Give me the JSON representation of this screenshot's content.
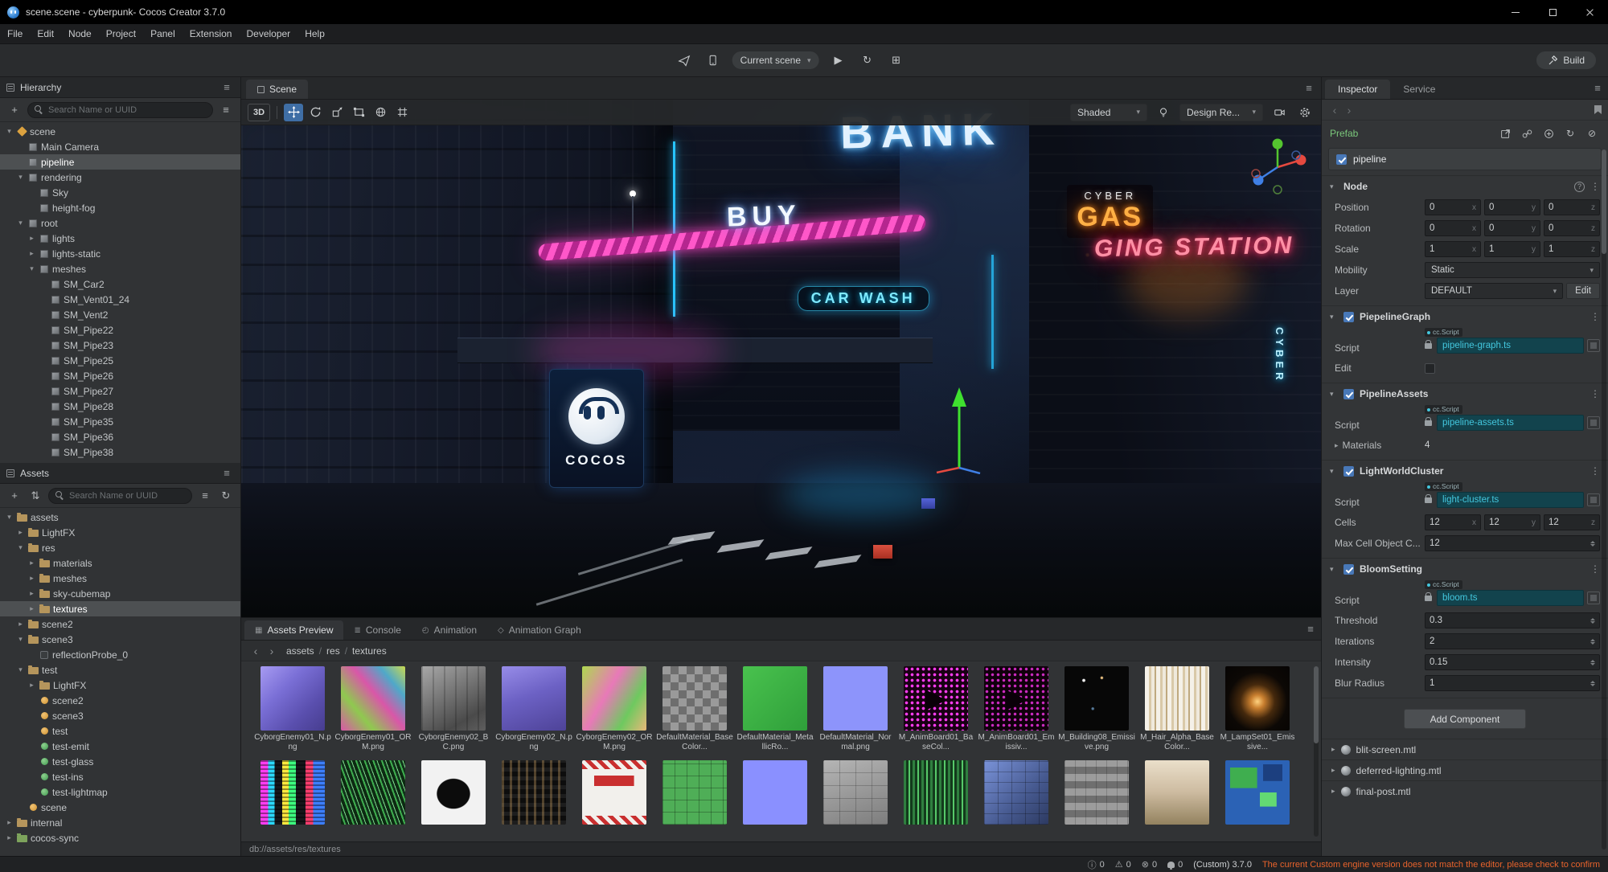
{
  "window": {
    "title": "scene.scene - cyberpunk- Cocos Creator 3.7.0"
  },
  "menubar": {
    "items": [
      "File",
      "Edit",
      "Node",
      "Project",
      "Panel",
      "Extension",
      "Developer",
      "Help"
    ]
  },
  "toolbar": {
    "scene_select": "Current scene",
    "build_label": "Build"
  },
  "hierarchy": {
    "title": "Hierarchy",
    "search_placeholder": "Search Name or UUID",
    "items": [
      {
        "label": "scene",
        "depth": 0,
        "icon": "scene",
        "arrow": "open"
      },
      {
        "label": "Main Camera",
        "depth": 1,
        "icon": "node"
      },
      {
        "label": "pipeline",
        "depth": 1,
        "icon": "node",
        "selected": true
      },
      {
        "label": "rendering",
        "depth": 1,
        "icon": "node",
        "arrow": "open"
      },
      {
        "label": "Sky",
        "depth": 2,
        "icon": "node"
      },
      {
        "label": "height-fog",
        "depth": 2,
        "icon": "node"
      },
      {
        "label": "root",
        "depth": 1,
        "icon": "node",
        "arrow": "open"
      },
      {
        "label": "lights",
        "depth": 2,
        "icon": "node",
        "arrow": "closed"
      },
      {
        "label": "lights-static",
        "depth": 2,
        "icon": "node",
        "arrow": "closed"
      },
      {
        "label": "meshes",
        "depth": 2,
        "icon": "node",
        "arrow": "open"
      },
      {
        "label": "SM_Car2",
        "depth": 3,
        "icon": "node"
      },
      {
        "label": "SM_Vent01_24",
        "depth": 3,
        "icon": "node"
      },
      {
        "label": "SM_Vent2",
        "depth": 3,
        "icon": "node"
      },
      {
        "label": "SM_Pipe22",
        "depth": 3,
        "icon": "node"
      },
      {
        "label": "SM_Pipe23",
        "depth": 3,
        "icon": "node"
      },
      {
        "label": "SM_Pipe25",
        "depth": 3,
        "icon": "node"
      },
      {
        "label": "SM_Pipe26",
        "depth": 3,
        "icon": "node"
      },
      {
        "label": "SM_Pipe27",
        "depth": 3,
        "icon": "node"
      },
      {
        "label": "SM_Pipe28",
        "depth": 3,
        "icon": "node"
      },
      {
        "label": "SM_Pipe35",
        "depth": 3,
        "icon": "node"
      },
      {
        "label": "SM_Pipe36",
        "depth": 3,
        "icon": "node"
      },
      {
        "label": "SM_Pipe38",
        "depth": 3,
        "icon": "node"
      }
    ]
  },
  "assets_panel": {
    "title": "Assets",
    "search_placeholder": "Search Name or UUID",
    "items": [
      {
        "label": "assets",
        "depth": 0,
        "icon": "folder",
        "arrow": "open"
      },
      {
        "label": "LightFX",
        "depth": 1,
        "icon": "folder",
        "arrow": "closed"
      },
      {
        "label": "res",
        "depth": 1,
        "icon": "folder",
        "arrow": "open"
      },
      {
        "label": "materials",
        "depth": 2,
        "icon": "folder",
        "arrow": "closed"
      },
      {
        "label": "meshes",
        "depth": 2,
        "icon": "folder",
        "arrow": "closed"
      },
      {
        "label": "sky-cubemap",
        "depth": 2,
        "icon": "folder",
        "arrow": "closed"
      },
      {
        "label": "textures",
        "depth": 2,
        "icon": "folder",
        "arrow": "closed",
        "selected": true
      },
      {
        "label": "scene2",
        "depth": 1,
        "icon": "folder",
        "arrow": "closed"
      },
      {
        "label": "scene3",
        "depth": 1,
        "icon": "folder",
        "arrow": "open"
      },
      {
        "label": "reflectionProbe_0",
        "depth": 2,
        "icon": "probe"
      },
      {
        "label": "test",
        "depth": 1,
        "icon": "folder",
        "arrow": "open"
      },
      {
        "label": "LightFX",
        "depth": 2,
        "icon": "folder",
        "arrow": "closed"
      },
      {
        "label": "scene2",
        "depth": 2,
        "icon": "scenefile"
      },
      {
        "label": "scene3",
        "depth": 2,
        "icon": "scenefile"
      },
      {
        "label": "test",
        "depth": 2,
        "icon": "scenefile"
      },
      {
        "label": "test-emit",
        "depth": 2,
        "icon": "material"
      },
      {
        "label": "test-glass",
        "depth": 2,
        "icon": "material"
      },
      {
        "label": "test-ins",
        "depth": 2,
        "icon": "material"
      },
      {
        "label": "test-lightmap",
        "depth": 2,
        "icon": "material"
      },
      {
        "label": "scene",
        "depth": 1,
        "icon": "scenefile"
      },
      {
        "label": "internal",
        "depth": 0,
        "icon": "folder",
        "arrow": "closed"
      },
      {
        "label": "cocos-sync",
        "depth": 0,
        "icon": "folder-sync",
        "arrow": "closed"
      }
    ]
  },
  "scene_view": {
    "tab": "Scene",
    "mode": "3D",
    "shading": "Shaded",
    "camera": "Design Re...",
    "signs": {
      "bank": "BANK",
      "buy": "BUY",
      "cyber": "CYBER",
      "gas": "GAS",
      "station": "GING STATION",
      "carwash": "CAR WASH",
      "cocos": "COCOS",
      "cyber_vert": "CYBER"
    }
  },
  "preview_panel": {
    "tabs": [
      {
        "label": "Assets Preview",
        "active": true
      },
      {
        "label": "Console",
        "active": false
      },
      {
        "label": "Animation",
        "active": false
      },
      {
        "label": "Animation Graph",
        "active": false
      }
    ],
    "breadcrumb": [
      "assets",
      "res",
      "textures"
    ],
    "status_path": "db://assets/res/textures",
    "thumbnails": [
      {
        "name": "CyborgEnemy01_N.png",
        "style": "nmap"
      },
      {
        "name": "CyborgEnemy01_ORM.png",
        "style": "orm1"
      },
      {
        "name": "CyborgEnemy02_BC.png",
        "style": "bcgray"
      },
      {
        "name": "CyborgEnemy02_N.png",
        "style": "nmap2"
      },
      {
        "name": "CyborgEnemy02_ORM.png",
        "style": "orm2"
      },
      {
        "name": "DefaultMaterial_BaseColor...",
        "style": "checker"
      },
      {
        "name": "DefaultMaterial_MetallicRo...",
        "style": "greenflat"
      },
      {
        "name": "DefaultMaterial_Normal.png",
        "style": "normalflat"
      },
      {
        "name": "M_AnimBoard01_BaseCol...",
        "style": "board",
        "overlay": "▶"
      },
      {
        "name": "M_AnimBoard01_Emissiv...",
        "style": "board2",
        "overlay": "▶"
      },
      {
        "name": "M_Building08_Emissive.png",
        "style": "buildingem"
      },
      {
        "name": "M_Hair_Alpha_BaseColor...",
        "style": "hair"
      },
      {
        "name": "M_LampSet01_Emissive...",
        "style": "lamp"
      }
    ],
    "thumbnails_row2": [
      {
        "style": "glitch"
      },
      {
        "style": "noisegreen"
      },
      {
        "style": "inkblot"
      },
      {
        "style": "windows"
      },
      {
        "style": "danger"
      },
      {
        "style": "tiles"
      },
      {
        "style": "periwinkle"
      },
      {
        "style": "graypanels"
      },
      {
        "style": "greennoise"
      },
      {
        "style": "bluepanels"
      },
      {
        "style": "grayboxes"
      },
      {
        "style": "beige"
      },
      {
        "style": "circuit"
      }
    ]
  },
  "inspector": {
    "tabs": [
      {
        "label": "Inspector",
        "active": true
      },
      {
        "label": "Service",
        "active": false
      }
    ],
    "prefab_label": "Prefab",
    "node_name": "pipeline",
    "axis": [
      "x",
      "y",
      "z"
    ],
    "node_section": {
      "title": "Node",
      "rows": [
        {
          "label": "Position",
          "type": "vec3",
          "values": [
            "0",
            "0",
            "0"
          ]
        },
        {
          "label": "Rotation",
          "type": "vec3",
          "values": [
            "0",
            "0",
            "0"
          ]
        },
        {
          "label": "Scale",
          "type": "vec3",
          "values": [
            "1",
            "1",
            "1"
          ]
        },
        {
          "label": "Mobility",
          "type": "select",
          "value": "Static"
        },
        {
          "label": "Layer",
          "type": "select_button",
          "value": "DEFAULT",
          "button": "Edit"
        }
      ]
    },
    "components": [
      {
        "title": "PiepelineGraph",
        "checked": true,
        "rows": [
          {
            "label": "Script",
            "type": "script",
            "value": "pipeline-graph.ts",
            "badge": "cc.Script"
          },
          {
            "label": "Edit",
            "type": "checkbox",
            "checked": false
          }
        ]
      },
      {
        "title": "PipelineAssets",
        "checked": true,
        "rows": [
          {
            "label": "Script",
            "type": "script",
            "value": "pipeline-assets.ts",
            "badge": "cc.Script"
          },
          {
            "label": "Materials",
            "type": "group_count",
            "value": "4"
          }
        ]
      },
      {
        "title": "LightWorldCluster",
        "checked": true,
        "rows": [
          {
            "label": "Script",
            "type": "script",
            "value": "light-cluster.ts",
            "badge": "cc.Script"
          },
          {
            "label": "Cells",
            "type": "vec3",
            "values": [
              "12",
              "12",
              "12"
            ]
          },
          {
            "label": "Max Cell Object C...",
            "type": "number",
            "value": "12"
          }
        ]
      },
      {
        "title": "BloomSetting",
        "checked": true,
        "rows": [
          {
            "label": "Script",
            "type": "script",
            "value": "bloom.ts",
            "badge": "cc.Script"
          },
          {
            "label": "Threshold",
            "type": "number",
            "value": "0.3"
          },
          {
            "label": "Iterations",
            "type": "number",
            "value": "2"
          },
          {
            "label": "Intensity",
            "type": "number",
            "value": "0.15"
          },
          {
            "label": "Blur Radius",
            "type": "number",
            "value": "1"
          }
        ]
      }
    ],
    "add_component_label": "Add Component",
    "materials": [
      "blit-screen.mtl",
      "deferred-lighting.mtl",
      "final-post.mtl"
    ]
  },
  "statusbar": {
    "info_count": "0",
    "warn_count": "0",
    "error_count": "0",
    "notify_count": "0",
    "engine_version": "(Custom) 3.7.0",
    "warning_message": "The current Custom engine version does not match the editor, please check to confirm"
  }
}
